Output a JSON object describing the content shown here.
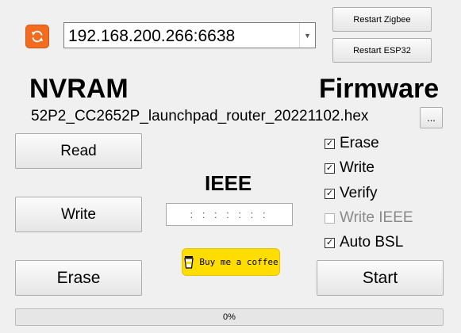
{
  "connection": {
    "address": "192.168.200.266:6638"
  },
  "buttons": {
    "restart_zigbee": "Restart Zigbee",
    "restart_esp32": "Restart ESP32",
    "read": "Read",
    "write": "Write",
    "erase": "Erase",
    "start": "Start",
    "browse": "..."
  },
  "sections": {
    "nvram": "NVRAM",
    "firmware": "Firmware",
    "ieee": "IEEE"
  },
  "firmware": {
    "filename": "52P2_CC2652P_launchpad_router_20221102.hex"
  },
  "ieee": {
    "value": ": : : : : : :"
  },
  "options": [
    {
      "label": "Erase",
      "checked": true,
      "enabled": true
    },
    {
      "label": "Write",
      "checked": true,
      "enabled": true
    },
    {
      "label": "Verify",
      "checked": true,
      "enabled": true
    },
    {
      "label": "Write IEEE",
      "checked": false,
      "enabled": false
    },
    {
      "label": "Auto BSL",
      "checked": true,
      "enabled": true
    }
  ],
  "coffee": {
    "label": "Buy me a coffee"
  },
  "progress": {
    "percent": 0,
    "label": "0%"
  },
  "colors": {
    "refresh_button": "#f26b1f",
    "coffee_button": "#ffdd00",
    "progress_fill": "#06b025"
  },
  "icons": {
    "refresh": "refresh-icon",
    "dropdown": "chevron-down-icon",
    "coffee": "coffee-cup-icon"
  }
}
